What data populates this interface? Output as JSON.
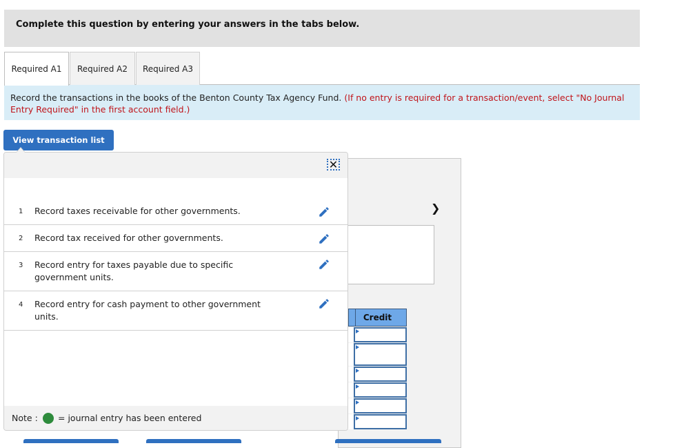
{
  "header": {
    "title": "Complete this question by entering your answers in the tabs below."
  },
  "tabs": [
    {
      "label": "Required A1",
      "active": true
    },
    {
      "label": "Required A2",
      "active": false
    },
    {
      "label": "Required A3",
      "active": false
    }
  ],
  "instructions": {
    "main": "Record the transactions in the books of the Benton County Tax Agency Fund.",
    "note": "(If no entry is required for a transaction/event, select \"No Journal Entry Required\" in the first account field.)"
  },
  "view_transaction_button": "View transaction list",
  "popup": {
    "close_icon": "close-icon",
    "transactions": [
      {
        "number": "1",
        "text": "Record taxes receivable for other governments.",
        "icon": "pencil-icon"
      },
      {
        "number": "2",
        "text": "Record tax received for other governments.",
        "icon": "pencil-icon"
      },
      {
        "number": "3",
        "text": "Record entry for taxes payable due to specific government units.",
        "icon": "pencil-icon"
      },
      {
        "number": "4",
        "text": "Record entry for cash payment to other government units.",
        "icon": "pencil-icon"
      }
    ],
    "note": {
      "label": "Note :",
      "text": "= journal entry has been entered",
      "dot_color": "#2e8b3c"
    }
  },
  "journal": {
    "next_icon": "chevron-right-icon",
    "credit_header": "Credit",
    "credit_values": [
      "",
      "",
      "",
      "",
      "",
      ""
    ]
  },
  "colors": {
    "accent": "#2f70c0",
    "instruction_bg": "#d9edf7",
    "note_red": "#c0141a",
    "table_header": "#6ea8e8"
  }
}
